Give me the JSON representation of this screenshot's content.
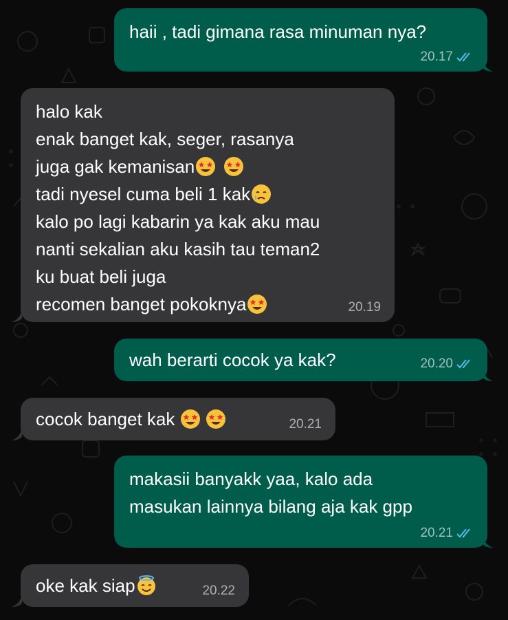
{
  "theme": {
    "background": "#0b0b0b",
    "outgoing_bubble": "#005c4b",
    "incoming_bubble": "#363638",
    "read_ticks": "#53bdeb"
  },
  "messages": [
    {
      "direction": "outgoing",
      "lines": [
        "haii , tadi gimana rasa minuman nya?"
      ],
      "time": "20.17",
      "status": "read"
    },
    {
      "direction": "incoming",
      "lines": [
        "halo kak",
        "enak banget kak, seger, rasanya",
        "juga gak kemanisan",
        "tadi nyesel cuma beli 1 kak",
        "kalo po lagi kabarin ya kak aku mau",
        "nanti sekalian aku kasih tau teman2",
        "ku buat beli juga",
        "recomen banget pokoknya"
      ],
      "emojis": [
        "star-struck-emoji",
        "star-struck-emoji",
        "crying-face-emoji",
        "star-struck-emoji"
      ],
      "time": "20.19"
    },
    {
      "direction": "outgoing",
      "lines": [
        "wah berarti cocok ya kak?"
      ],
      "time": "20.20",
      "status": "read"
    },
    {
      "direction": "incoming",
      "lines": [
        "cocok banget kak"
      ],
      "emojis": [
        "star-struck-emoji",
        "star-struck-emoji"
      ],
      "time": "20.21"
    },
    {
      "direction": "outgoing",
      "lines": [
        "makasii banyakk yaa, kalo ada",
        "masukan lainnya bilang aja kak gpp"
      ],
      "time": "20.21",
      "status": "read"
    },
    {
      "direction": "incoming",
      "lines": [
        "oke kak siap"
      ],
      "emojis": [
        "smiling-face-with-halo-emoji"
      ],
      "time": "20.22"
    }
  ]
}
